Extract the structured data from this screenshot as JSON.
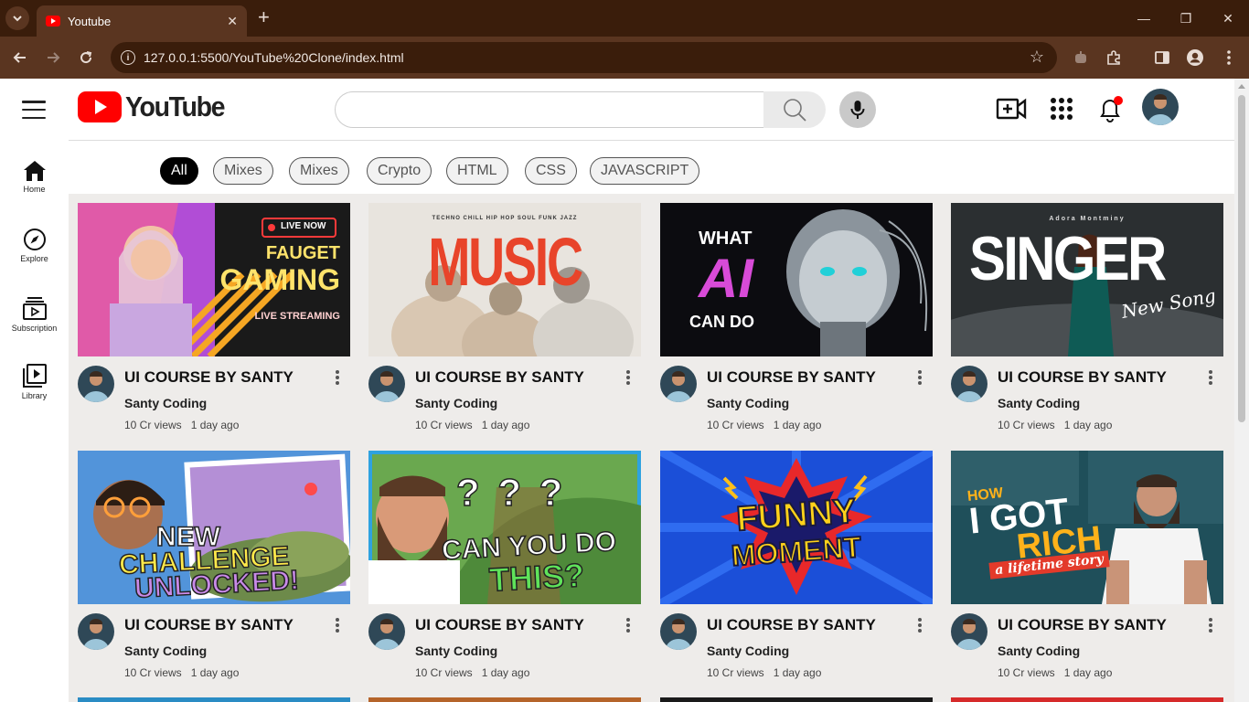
{
  "browser": {
    "tab_title": "Youtube",
    "url": "127.0.0.1:5500/YouTube%20Clone/index.html"
  },
  "header": {
    "logo_text": "YouTube",
    "search_placeholder": ""
  },
  "sidebar": {
    "items": [
      {
        "label": "Home",
        "icon": "home-icon"
      },
      {
        "label": "Explore",
        "icon": "compass-icon"
      },
      {
        "label": "Subscription",
        "icon": "subscriptions-icon"
      },
      {
        "label": "Library",
        "icon": "library-icon"
      }
    ]
  },
  "chips": [
    "All",
    "Mixes",
    "Mixes",
    "Crypto",
    "HTML",
    "CSS",
    "JAVASCRIPT"
  ],
  "videos": [
    {
      "title": "UI COURSE BY SANTY",
      "channel": "Santy Coding",
      "views": "10 Cr views",
      "age": "1 day ago",
      "thumb_text": [
        "LIVE NOW",
        "FAUGET",
        "GAMING",
        "LIVE STREAMING"
      ]
    },
    {
      "title": "UI COURSE BY SANTY",
      "channel": "Santy Coding",
      "views": "10 Cr views",
      "age": "1 day ago",
      "thumb_text": [
        "MUSIC",
        "TECHNO  CHILL  HIP HOP  SOUL  FUNK  JAZZ"
      ]
    },
    {
      "title": "UI COURSE BY SANTY",
      "channel": "Santy Coding",
      "views": "10 Cr views",
      "age": "1 day ago",
      "thumb_text": [
        "WHAT",
        "AI",
        "CAN DO"
      ]
    },
    {
      "title": "UI COURSE BY SANTY",
      "channel": "Santy Coding",
      "views": "10 Cr views",
      "age": "1 day ago",
      "thumb_text": [
        "Adora Montminy",
        "SINGER",
        "New Song"
      ]
    },
    {
      "title": "UI COURSE BY SANTY",
      "channel": "Santy Coding",
      "views": "10 Cr views",
      "age": "1 day ago",
      "thumb_text": [
        "NEW",
        "CHALLENGE",
        "UNLOCKED!"
      ]
    },
    {
      "title": "UI COURSE BY SANTY",
      "channel": "Santy Coding",
      "views": "10 Cr views",
      "age": "1 day ago",
      "thumb_text": [
        "? ? ?",
        "CAN YOU DO",
        "THIS?"
      ]
    },
    {
      "title": "UI COURSE BY SANTY",
      "channel": "Santy Coding",
      "views": "10 Cr views",
      "age": "1 day ago",
      "thumb_text": [
        "FUNNY",
        "MOMENT"
      ]
    },
    {
      "title": "UI COURSE BY SANTY",
      "channel": "Santy Coding",
      "views": "10 Cr views",
      "age": "1 day ago",
      "thumb_text": [
        "HOW",
        "I GOT",
        "RICH",
        "a lifetime story"
      ]
    }
  ],
  "colors": {
    "brand_red": "#ff0000",
    "chrome_dark": "#3a1d0b",
    "chrome_mid": "#5a3520",
    "grid_bg": "#eeecea",
    "notification_dot": "#ff0000"
  }
}
